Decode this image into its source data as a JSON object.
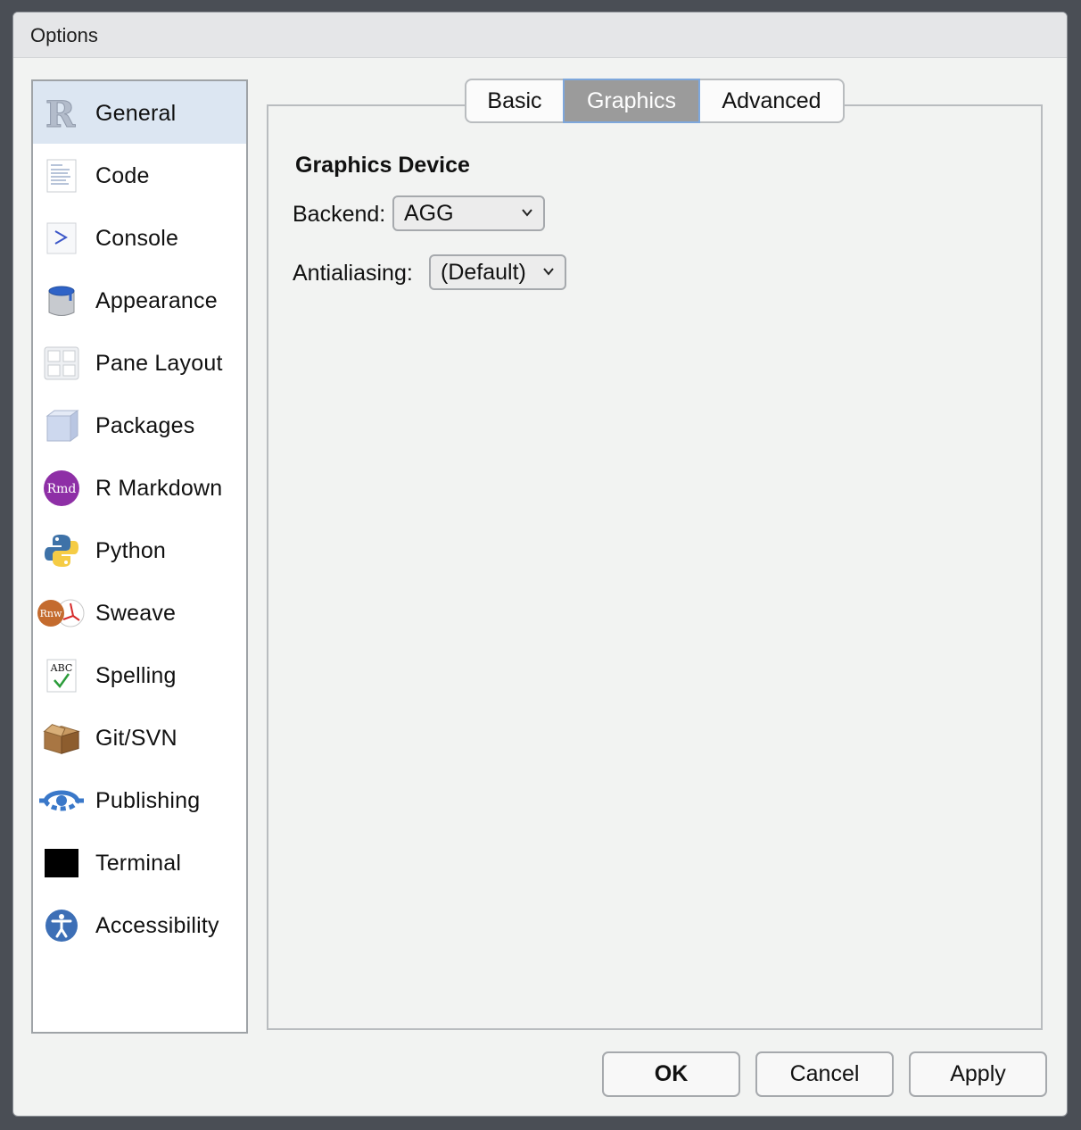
{
  "window": {
    "title": "Options"
  },
  "sidebar": {
    "items": [
      {
        "label": "General",
        "icon": "r-logo-icon",
        "active": true
      },
      {
        "label": "Code",
        "icon": "code-document-icon"
      },
      {
        "label": "Console",
        "icon": "console-prompt-icon"
      },
      {
        "label": "Appearance",
        "icon": "paint-bucket-icon"
      },
      {
        "label": "Pane Layout",
        "icon": "pane-grid-icon"
      },
      {
        "label": "Packages",
        "icon": "package-cube-icon"
      },
      {
        "label": "R Markdown",
        "icon": "rmd-icon",
        "icon_text": "Rmd"
      },
      {
        "label": "Python",
        "icon": "python-logo-icon"
      },
      {
        "label": "Sweave",
        "icon": "sweave-pdf-icon",
        "icon_text": "Rnw"
      },
      {
        "label": "Spelling",
        "icon": "spellcheck-icon",
        "icon_text": "ABC"
      },
      {
        "label": "Git/SVN",
        "icon": "cardboard-box-icon"
      },
      {
        "label": "Publishing",
        "icon": "publish-icon"
      },
      {
        "label": "Terminal",
        "icon": "terminal-icon"
      },
      {
        "label": "Accessibility",
        "icon": "accessibility-icon"
      }
    ]
  },
  "tabs": [
    {
      "label": "Basic"
    },
    {
      "label": "Graphics",
      "selected": true
    },
    {
      "label": "Advanced"
    }
  ],
  "graphics": {
    "section_title": "Graphics Device",
    "backend_label": "Backend:",
    "backend_value": "AGG",
    "antialiasing_label": "Antialiasing:",
    "antialiasing_value": "(Default)"
  },
  "buttons": {
    "ok": "OK",
    "cancel": "Cancel",
    "apply": "Apply"
  },
  "colors": {
    "active_item": "#dce6f2",
    "selected_tab": "#9b9b9b",
    "tab_focus": "#7ea7dc"
  }
}
